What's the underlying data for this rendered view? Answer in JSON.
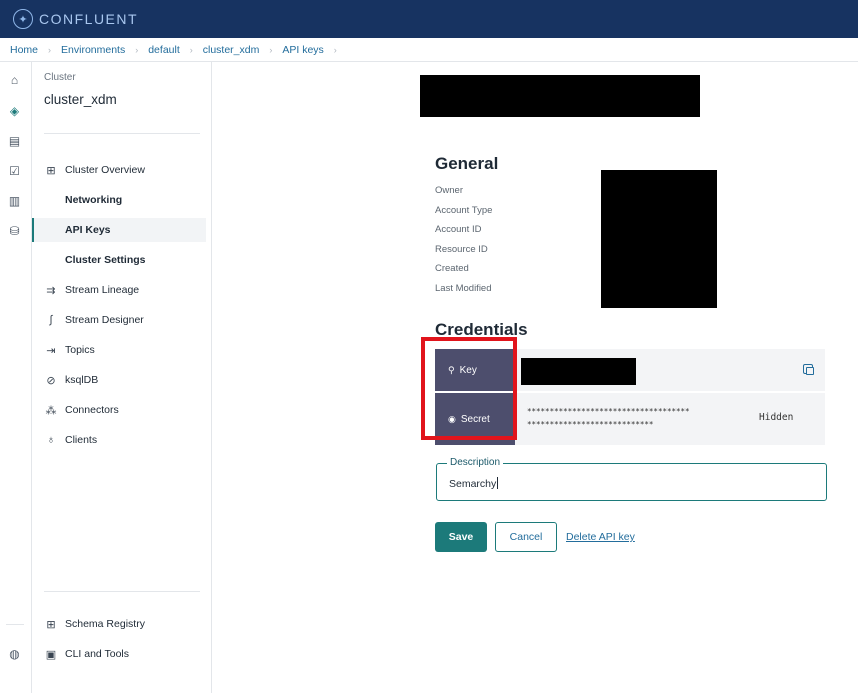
{
  "header": {
    "brand": "CONFLUENT"
  },
  "breadcrumb": [
    "Home",
    "Environments",
    "default",
    "cluster_xdm",
    "API keys"
  ],
  "sidebar": {
    "cluster_label": "Cluster",
    "cluster_name": "cluster_xdm",
    "items": [
      {
        "label": "Cluster Overview",
        "icon": "grid-icon"
      },
      {
        "label": "Networking"
      },
      {
        "label": "API Keys",
        "active": true
      },
      {
        "label": "Cluster Settings"
      },
      {
        "label": "Stream Lineage",
        "icon": "lineage-icon"
      },
      {
        "label": "Stream Designer",
        "icon": "designer-icon"
      },
      {
        "label": "Topics",
        "icon": "topics-icon"
      },
      {
        "label": "ksqlDB",
        "icon": "ksqldb-icon"
      },
      {
        "label": "Connectors",
        "icon": "connectors-icon"
      },
      {
        "label": "Clients",
        "icon": "clients-icon"
      }
    ],
    "bottom_items": [
      {
        "label": "Schema Registry",
        "icon": "schema-icon"
      },
      {
        "label": "CLI and Tools",
        "icon": "terminal-icon"
      }
    ]
  },
  "general": {
    "title": "General",
    "fields": [
      "Owner",
      "Account Type",
      "Account ID",
      "Resource ID",
      "Created",
      "Last Modified"
    ]
  },
  "credentials": {
    "title": "Credentials",
    "key_label": "Key",
    "secret_label": "Secret",
    "secret_line1": "************************************",
    "secret_line2": "****************************",
    "secret_state": "Hidden"
  },
  "description": {
    "label": "Description",
    "value": "Semarchy"
  },
  "actions": {
    "save": "Save",
    "cancel": "Cancel",
    "delete": "Delete API key"
  },
  "colors": {
    "header_bg": "#173361",
    "accent": "#1c7a7a",
    "credential_tab": "#4d4e6d",
    "highlight": "#e1141c"
  }
}
